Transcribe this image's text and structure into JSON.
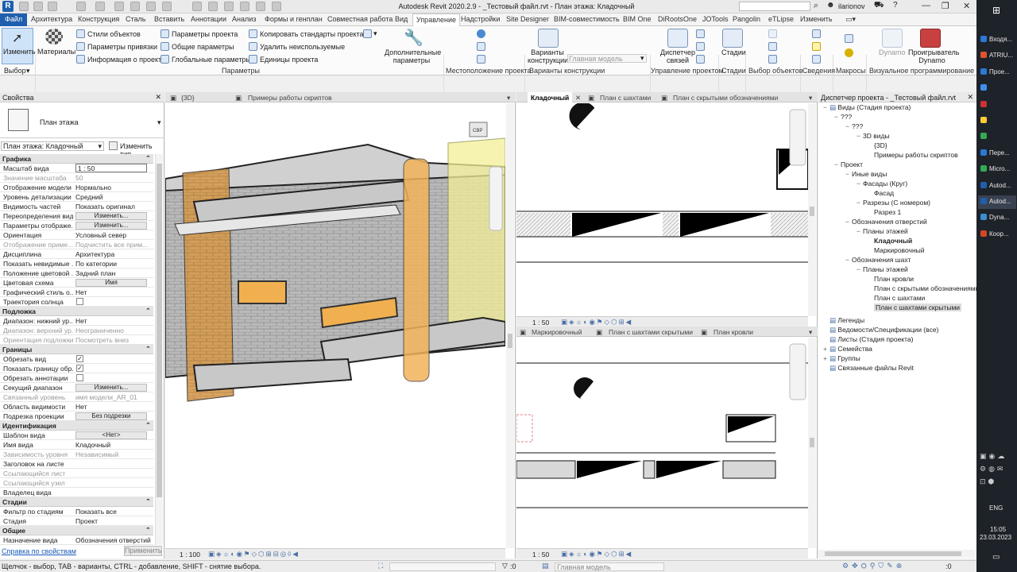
{
  "app": {
    "title": "Autodesk Revit 2020.2.9 - _Тестовый файл.rvt - План этажа: Кладочный",
    "user": "ilarionov"
  },
  "tabs": [
    "Файл",
    "Архитектура",
    "Конструкция",
    "Сталь",
    "Вставить",
    "Аннотации",
    "Анализ",
    "Формы и генплан",
    "Совместная работа",
    "Вид",
    "Управление",
    "Надстройки",
    "Site Designer",
    "BIM-совместимость",
    "BIM One",
    "DiRootsOne",
    "JOTools",
    "Pangolin",
    "eTLipse",
    "Изменить"
  ],
  "ribbon": {
    "modify": "Изменить",
    "select_panel": "Выбор",
    "materials": "Материалы",
    "object_styles": "Стили объектов",
    "snaps": "Параметры привязки",
    "project_info": "Информация о проекте",
    "project_params": "Параметры проекта",
    "shared_params": "Общие параметры",
    "global_params": "Глобальные  параметры",
    "transfer_standards": "Копировать стандарты проекта",
    "purge": "Удалить неиспользуемые",
    "units": "Единицы проекта",
    "params_panel": "Параметры",
    "additional_settings": "Дополнительные параметры",
    "location_panel": "Местоположение проекта",
    "design_options": "Варианты конструкции",
    "main_model": "Главная модель",
    "design_options_panel": "Варианты конструкции",
    "links_manager": "Диспетчер связей",
    "manage_project_panel": "Управление проектом",
    "phases": "Стадии",
    "phases_panel": "Стадии",
    "selection_panel": "Выбор объектов",
    "inquiry_panel": "Сведения",
    "macros_panel": "Макросы",
    "dynamo": "Dynamo",
    "dynamo_player": "Проигрыватель Dynamo",
    "visual_prog_panel": "Визуальное программирование"
  },
  "properties": {
    "header": "Свойства",
    "type_name": "План этажа",
    "instance_selector": "План этажа: Кладочный",
    "edit_type": "Изменить тип",
    "groups": [
      {
        "name": "Графика",
        "rows": [
          {
            "k": "Масштаб вида",
            "v": "1 : 50",
            "box": true
          },
          {
            "k": "Значение масштаба",
            "v": "50",
            "dis": true
          },
          {
            "k": "Отображение модели",
            "v": "Нормально"
          },
          {
            "k": "Уровень детализации",
            "v": "Средний"
          },
          {
            "k": "Видимость частей",
            "v": "Показать оригинал"
          },
          {
            "k": "Переопределения вид...",
            "v": "Изменить...",
            "btn": true
          },
          {
            "k": "Параметры отображе...",
            "v": "Изменить...",
            "btn": true
          },
          {
            "k": "Ориентация",
            "v": "Условный север"
          },
          {
            "k": "Отображение приме...",
            "v": "Подчистить все прим...",
            "dis": true
          },
          {
            "k": "Дисциплина",
            "v": "Архитектура"
          },
          {
            "k": "Показать невидимые ...",
            "v": "По категории"
          },
          {
            "k": "Положение цветовой ...",
            "v": "Задний план"
          },
          {
            "k": "Цветовая схема",
            "v": "Имя",
            "btn": true
          },
          {
            "k": "Графический стиль о...",
            "v": "Нет"
          },
          {
            "k": "Траектория солнца",
            "v": "",
            "chk": false
          }
        ]
      },
      {
        "name": "Подложка",
        "rows": [
          {
            "k": "Диапазон: нижний ур...",
            "v": "Нет"
          },
          {
            "k": "Диапазон: верхний ур...",
            "v": "Неограниченно",
            "dis": true
          },
          {
            "k": "Ориентация подложки",
            "v": "Посмотреть вниз",
            "dis": true
          }
        ]
      },
      {
        "name": "Границы",
        "rows": [
          {
            "k": "Обрезать вид",
            "v": "",
            "chk": true
          },
          {
            "k": "Показать границу обр...",
            "v": "",
            "chk": true
          },
          {
            "k": "Обрезать аннотации",
            "v": "",
            "chk": false
          },
          {
            "k": "Секущий диапазон",
            "v": "Изменить...",
            "btn": true
          },
          {
            "k": "Связанный уровень",
            "v": "имя модели_AR_01",
            "dis": true
          },
          {
            "k": "Область видимости",
            "v": "Нет"
          },
          {
            "k": "Подрезка проекции",
            "v": "Без подрезки",
            "btn": true
          }
        ]
      },
      {
        "name": "Идентификация",
        "rows": [
          {
            "k": "Шаблон вида",
            "v": "<Нет>",
            "btn": true
          },
          {
            "k": "Имя вида",
            "v": "Кладочный"
          },
          {
            "k": "Зависимость уровня",
            "v": "Независимый",
            "dis": true
          },
          {
            "k": "Заголовок на листе",
            "v": ""
          },
          {
            "k": "Ссылающийся лист",
            "v": "",
            "dis": true
          },
          {
            "k": "Ссылающийся узел",
            "v": "",
            "dis": true
          },
          {
            "k": "Владелец вида",
            "v": ""
          }
        ]
      },
      {
        "name": "Стадии",
        "rows": [
          {
            "k": "Фильтр по стадиям",
            "v": "Показать все"
          },
          {
            "k": "Стадия",
            "v": "Проект"
          }
        ]
      },
      {
        "name": "Общие",
        "rows": [
          {
            "k": "Назначение вида",
            "v": "Обозначения отверстий"
          }
        ]
      }
    ],
    "help_link": "Справка по свойствам",
    "apply": "Применить"
  },
  "views": {
    "left_tabs": [
      "{3D}",
      "Примеры работы скриптов"
    ],
    "left_scale": "1 : 100",
    "top_tabs": [
      "Кладочный",
      "План с шахтами",
      "План с скрытыми обозначениями"
    ],
    "top_scale": "1 : 50",
    "bottom_tabs": [
      "Маркировочный",
      "План с шахтами скрытыми",
      "План кровли"
    ],
    "bottom_scale": "1 : 50",
    "viewcube_label": "СВР"
  },
  "browser": {
    "header": "Диспетчер проекта - _Тестовый файл.rvt",
    "nodes": [
      {
        "t": "Виды (Стадия проекта)",
        "lvl": 0,
        "g": "−"
      },
      {
        "t": "???",
        "lvl": 1,
        "g": "−"
      },
      {
        "t": "???",
        "lvl": 2,
        "g": "−"
      },
      {
        "t": "3D виды",
        "lvl": 3,
        "g": "−"
      },
      {
        "t": "{3D}",
        "lvl": 4,
        "g": ""
      },
      {
        "t": "Примеры работы скриптов",
        "lvl": 4,
        "g": ""
      },
      {
        "t": "Проект",
        "lvl": 1,
        "g": "−"
      },
      {
        "t": "Иные виды",
        "lvl": 2,
        "g": "−"
      },
      {
        "t": "Фасады (Круг)",
        "lvl": 3,
        "g": "−"
      },
      {
        "t": "Фасад",
        "lvl": 4,
        "g": ""
      },
      {
        "t": "Разрезы (С номером)",
        "lvl": 3,
        "g": "−"
      },
      {
        "t": "Разрез 1",
        "lvl": 4,
        "g": ""
      },
      {
        "t": "Обозначения отверстий",
        "lvl": 2,
        "g": "−"
      },
      {
        "t": "Планы этажей",
        "lvl": 3,
        "g": "−"
      },
      {
        "t": "Кладочный",
        "lvl": 4,
        "g": "",
        "bold": true
      },
      {
        "t": "Маркировочный",
        "lvl": 4,
        "g": ""
      },
      {
        "t": "Обозначения шахт",
        "lvl": 2,
        "g": "−"
      },
      {
        "t": "Планы этажей",
        "lvl": 3,
        "g": "−"
      },
      {
        "t": "План кровли",
        "lvl": 4,
        "g": ""
      },
      {
        "t": "План с скрытыми обозначениями",
        "lvl": 4,
        "g": ""
      },
      {
        "t": "План с шахтами",
        "lvl": 4,
        "g": ""
      },
      {
        "t": "План с шахтами скрытыми",
        "lvl": 4,
        "g": "",
        "sel": true
      },
      {
        "t": "Легенды",
        "lvl": 0,
        "g": ""
      },
      {
        "t": "Ведомости/Спецификации (все)",
        "lvl": 0,
        "g": ""
      },
      {
        "t": "Листы (Стадия проекта)",
        "lvl": 0,
        "g": ""
      },
      {
        "t": "Семейства",
        "lvl": 0,
        "g": "+"
      },
      {
        "t": "Группы",
        "lvl": 0,
        "g": "+"
      },
      {
        "t": "Связанные файлы Revit",
        "lvl": 0,
        "g": ""
      }
    ]
  },
  "status": {
    "hint": "Щелчок - выбор, TAB - варианты, CTRL - добавление, SHIFT - снятие выбора.",
    "count": ":0",
    "model": "Главная модель"
  },
  "taskbar": {
    "items": [
      {
        "t": "Входя...",
        "c": "#2b78d6"
      },
      {
        "t": "ATRIU...",
        "c": "#e0532f"
      },
      {
        "t": "Прое...",
        "c": "#2b78d6"
      },
      {
        "t": "",
        "c": "#3f8ff0"
      },
      {
        "t": "",
        "c": "#cc3333"
      },
      {
        "t": "",
        "c": "#ffcc33"
      },
      {
        "t": "",
        "c": "#33aa55"
      },
      {
        "t": "Пере...",
        "c": "#2b78d6"
      },
      {
        "t": "Micro...",
        "c": "#33aa55"
      },
      {
        "t": "Autod...",
        "c": "#1f5fae"
      },
      {
        "t": "Autod...",
        "c": "#1f5fae",
        "act": true
      },
      {
        "t": "Dyna...",
        "c": "#3a8fd0"
      },
      {
        "t": "Коор...",
        "c": "#d24726"
      }
    ],
    "lang": "ENG",
    "time": "15:05",
    "date": "23.03.2023"
  }
}
